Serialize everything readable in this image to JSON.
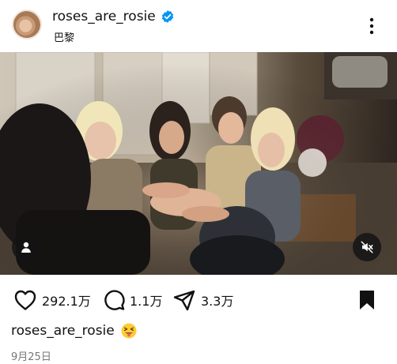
{
  "post": {
    "username": "roses_are_rosie",
    "location": "巴黎",
    "likes": "292.1万",
    "comments": "1.1万",
    "shares": "3.3万",
    "caption_user": "roses_are_rosie",
    "date": "9月25日"
  },
  "icons": {
    "verified": "verified-badge-icon",
    "more": "more-options-icon",
    "like": "heart-icon",
    "comment": "comment-icon",
    "share": "send-icon",
    "bookmark": "bookmark-icon",
    "user_tag": "user-tag-icon",
    "mute": "mute-icon",
    "emoji": "squinting-tongue-emoji"
  },
  "colors": {
    "verified_blue": "#0095f6",
    "text": "#111111",
    "date_gray": "#777777"
  }
}
